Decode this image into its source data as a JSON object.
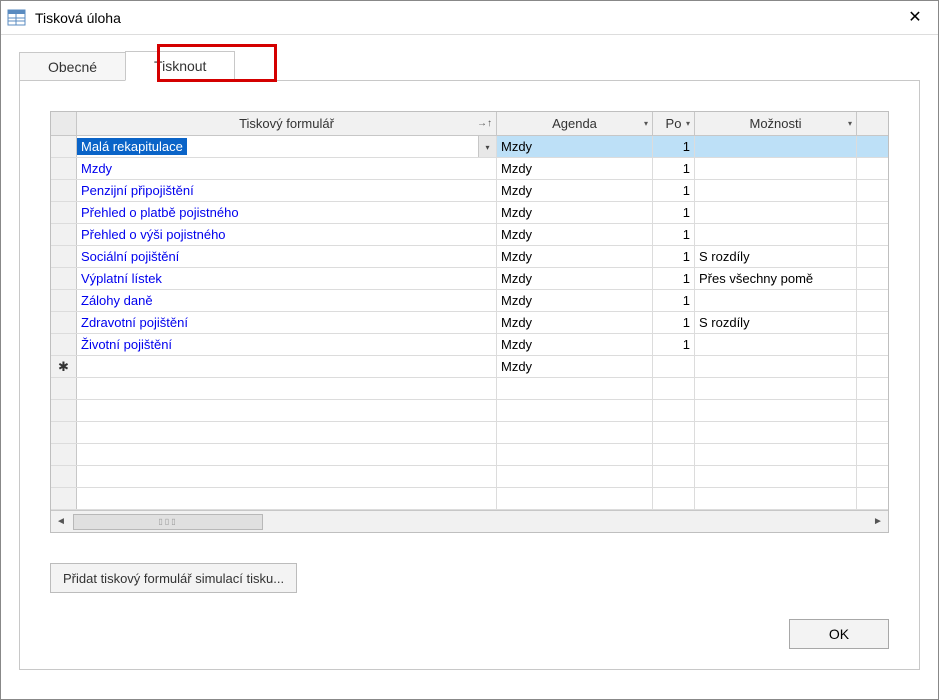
{
  "window": {
    "title": "Tisková úloha"
  },
  "tabs": {
    "general": "Obecné",
    "print": "Tisknout"
  },
  "grid": {
    "headers": {
      "form": "Tiskový formulář",
      "agenda": "Agenda",
      "po": "Po",
      "options": "Možnosti"
    },
    "rows": [
      {
        "form": "Malá rekapitulace",
        "agenda": "Mzdy",
        "po": "1",
        "options": "",
        "selected": true
      },
      {
        "form": "Mzdy",
        "agenda": "Mzdy",
        "po": "1",
        "options": ""
      },
      {
        "form": "Penzijní připojištění",
        "agenda": "Mzdy",
        "po": "1",
        "options": ""
      },
      {
        "form": "Přehled o platbě pojistného",
        "agenda": "Mzdy",
        "po": "1",
        "options": ""
      },
      {
        "form": "Přehled o výši pojistného",
        "agenda": "Mzdy",
        "po": "1",
        "options": ""
      },
      {
        "form": "Sociální pojištění",
        "agenda": "Mzdy",
        "po": "1",
        "options": "S rozdíly"
      },
      {
        "form": "Výplatní lístek",
        "agenda": "Mzdy",
        "po": "1",
        "options": "Přes všechny pomě"
      },
      {
        "form": "Zálohy daně",
        "agenda": "Mzdy",
        "po": "1",
        "options": ""
      },
      {
        "form": "Zdravotní pojištění",
        "agenda": "Mzdy",
        "po": "1",
        "options": "S rozdíly"
      },
      {
        "form": "Životní pojištění",
        "agenda": "Mzdy",
        "po": "1",
        "options": ""
      },
      {
        "form": "",
        "agenda": "Mzdy",
        "po": "",
        "options": "",
        "new": true
      }
    ]
  },
  "buttons": {
    "add": "Přidat tiskový formulář simulací tisku...",
    "ok": "OK"
  }
}
